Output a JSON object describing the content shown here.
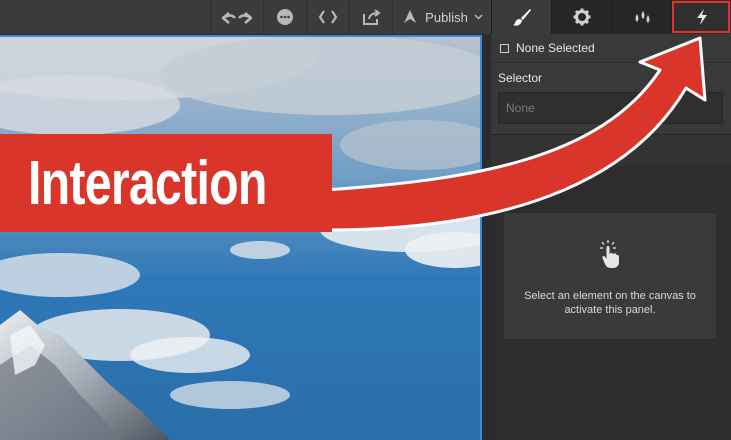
{
  "toolbar": {
    "publish_label": "Publish"
  },
  "panel": {
    "tabs": [
      {
        "name": "style",
        "icon": "paintbrush-icon",
        "active": true
      },
      {
        "name": "settings",
        "icon": "gear-icon",
        "active": false
      },
      {
        "name": "style-manager",
        "icon": "droplets-icon",
        "active": false
      },
      {
        "name": "interactions",
        "icon": "lightning-icon",
        "active": false,
        "highlighted": true
      }
    ],
    "selection_label": "None Selected",
    "selector_label": "Selector",
    "selector_placeholder": "None",
    "empty_message": "Select an element on the canvas to activate this panel."
  },
  "annotation": {
    "banner_text": "Interaction",
    "color": "#d9352a"
  },
  "colors": {
    "accent_blue": "#3b8ad9",
    "annotation_red": "#d9352a"
  }
}
